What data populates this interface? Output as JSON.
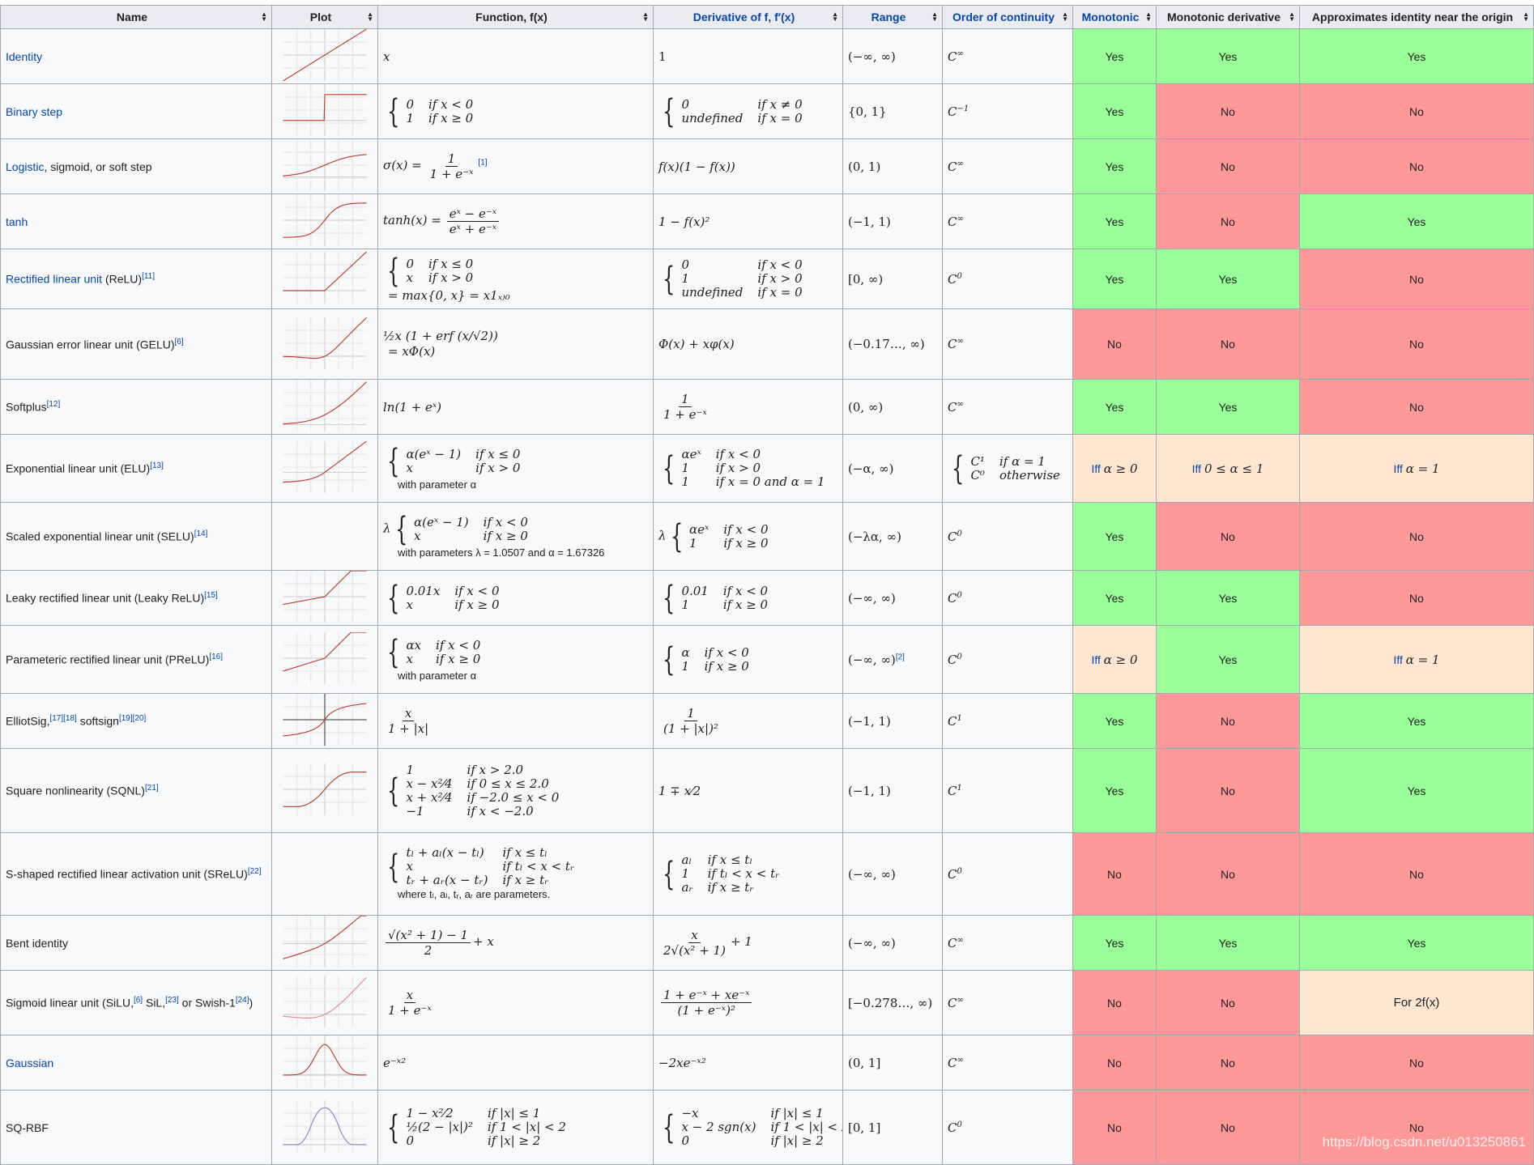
{
  "colors": {
    "yes": "#9f9",
    "no": "#f99",
    "partial": "#ffe6d0",
    "link": "#0645ad",
    "header_bg": "#eaecf0",
    "border": "#a2a9b1"
  },
  "headers": [
    {
      "label": "Name",
      "link": false
    },
    {
      "label": "Plot",
      "link": false,
      "nosort": false
    },
    {
      "label": "Function, f(x)",
      "link": false
    },
    {
      "label": "Derivative of f, f′(x)",
      "link": true
    },
    {
      "label": "Range",
      "link": true
    },
    {
      "label": "Order of continuity",
      "link": true
    },
    {
      "label": "Monotonic",
      "link": true
    },
    {
      "label": "Monotonic derivative",
      "link": false
    },
    {
      "label": "Approximates identity near the origin",
      "link": false
    }
  ],
  "sort_icon": "sort-arrows-icon",
  "rows": [
    {
      "name": [
        {
          "t": "Identity",
          "link": true
        }
      ],
      "plot": "identity",
      "f": {
        "text": "x"
      },
      "d": {
        "text": "1",
        "up": true
      },
      "range": "(−∞, ∞)",
      "cont": {
        "base": "C",
        "sup": "∞"
      },
      "mono": {
        "t": "Yes",
        "s": "yes"
      },
      "monod": {
        "t": "Yes",
        "s": "yes"
      },
      "approx": {
        "t": "Yes",
        "s": "yes"
      }
    },
    {
      "name": [
        {
          "t": "Binary step",
          "link": true
        }
      ],
      "plot": "step",
      "f": {
        "cases": [
          [
            "0",
            "if x < 0"
          ],
          [
            "1",
            "if x ≥ 0"
          ]
        ]
      },
      "d": {
        "cases": [
          [
            "0",
            "if x ≠ 0"
          ],
          [
            "undefined",
            "if x = 0"
          ]
        ]
      },
      "range": "{0, 1}",
      "cont": {
        "base": "C",
        "sup": "−1"
      },
      "mono": {
        "t": "Yes",
        "s": "yes"
      },
      "monod": {
        "t": "No",
        "s": "no"
      },
      "approx": {
        "t": "No",
        "s": "no"
      }
    },
    {
      "name": [
        {
          "t": "Logistic",
          "link": true
        },
        {
          "t": ", sigmoid, or soft step"
        }
      ],
      "plot": "logistic",
      "f": {
        "pre": "σ(x) =",
        "frac": {
          "num": "1",
          "den": "1 + e⁻ˣ"
        },
        "ref": "[1]"
      },
      "d": {
        "text": "f(x)(1 − f(x))"
      },
      "range": "(0, 1)",
      "cont": {
        "base": "C",
        "sup": "∞"
      },
      "mono": {
        "t": "Yes",
        "s": "yes"
      },
      "monod": {
        "t": "No",
        "s": "no"
      },
      "approx": {
        "t": "No",
        "s": "no"
      }
    },
    {
      "name": [
        {
          "t": "tanh",
          "link": true
        }
      ],
      "plot": "tanh",
      "f": {
        "pre": "tanh(x) =",
        "frac": {
          "num": "eˣ − e⁻ˣ",
          "den": "eˣ + e⁻ˣ"
        }
      },
      "d": {
        "text": "1 − f(x)²"
      },
      "range": "(−1, 1)",
      "cont": {
        "base": "C",
        "sup": "∞"
      },
      "mono": {
        "t": "Yes",
        "s": "yes"
      },
      "monod": {
        "t": "No",
        "s": "no"
      },
      "approx": {
        "t": "Yes",
        "s": "yes"
      }
    },
    {
      "name": [
        {
          "t": "Rectified linear unit",
          "link": true
        },
        {
          "t": " (ReLU)"
        },
        {
          "t": "[11]",
          "sup": true
        }
      ],
      "plot": "relu",
      "f": {
        "cases": [
          [
            "0",
            "if x ≤ 0"
          ],
          [
            "x",
            "if x > 0"
          ]
        ],
        "after": "= max{0, x} = x1ₓ₎₀"
      },
      "d": {
        "cases": [
          [
            "0",
            "if x < 0"
          ],
          [
            "1",
            "if x > 0"
          ],
          [
            "undefined",
            "if x = 0"
          ]
        ]
      },
      "range": "[0, ∞)",
      "cont": {
        "base": "C",
        "sup": "0"
      },
      "mono": {
        "t": "Yes",
        "s": "yes"
      },
      "monod": {
        "t": "Yes",
        "s": "yes"
      },
      "approx": {
        "t": "No",
        "s": "no"
      }
    },
    {
      "name": [
        {
          "t": "Gaussian error linear unit (GELU)"
        },
        {
          "t": "[6]",
          "sup": true
        }
      ],
      "plot": "gelu",
      "f": {
        "text": "½x (1 + erf (x/√2))",
        "after": "= xΦ(x)"
      },
      "d": {
        "text": "Φ(x) + xφ(x)"
      },
      "range": "(−0.17…, ∞)",
      "cont": {
        "base": "C",
        "sup": "∞"
      },
      "mono": {
        "t": "No",
        "s": "no"
      },
      "monod": {
        "t": "No",
        "s": "no"
      },
      "approx": {
        "t": "No",
        "s": "no"
      }
    },
    {
      "name": [
        {
          "t": "Softplus"
        },
        {
          "t": "[12]",
          "sup": true
        }
      ],
      "plot": "softplus",
      "f": {
        "text": "ln(1 + eˣ)"
      },
      "d": {
        "frac": {
          "num": "1",
          "den": "1 + e⁻ˣ"
        }
      },
      "range": "(0, ∞)",
      "cont": {
        "base": "C",
        "sup": "∞"
      },
      "mono": {
        "t": "Yes",
        "s": "yes"
      },
      "monod": {
        "t": "Yes",
        "s": "yes"
      },
      "approx": {
        "t": "No",
        "s": "no"
      }
    },
    {
      "name": [
        {
          "t": "Exponential linear unit (ELU)"
        },
        {
          "t": "[13]",
          "sup": true
        }
      ],
      "plot": "elu",
      "f": {
        "cases": [
          [
            "α(eˣ − 1)",
            "if x ≤ 0"
          ],
          [
            "x",
            "if x > 0"
          ]
        ],
        "note": "with parameter α"
      },
      "d": {
        "cases": [
          [
            "αeˣ",
            "if x < 0"
          ],
          [
            "1",
            "if x > 0"
          ],
          [
            "1",
            "if x = 0 and α = 1"
          ]
        ]
      },
      "range": "(−α, ∞)",
      "cont": {
        "cases": [
          [
            "C¹",
            "if α = 1"
          ],
          [
            "C⁰",
            "otherwise"
          ]
        ]
      },
      "mono": {
        "iff": "Iff",
        "t": "α ≥ 0",
        "s": "partial"
      },
      "monod": {
        "iff": "Iff",
        "t": "0 ≤ α ≤ 1",
        "s": "partial"
      },
      "approx": {
        "iff": "Iff",
        "t": "α = 1",
        "s": "partial"
      }
    },
    {
      "name": [
        {
          "t": "Scaled exponential linear unit (SELU)"
        },
        {
          "t": "[14]",
          "sup": true
        }
      ],
      "plot": "",
      "f": {
        "prefix": "λ",
        "cases": [
          [
            "α(eˣ − 1)",
            "if x < 0"
          ],
          [
            "x",
            "if x ≥ 0"
          ]
        ],
        "note": "with parameters λ = 1.0507 and α = 1.67326"
      },
      "d": {
        "prefix": "λ",
        "cases": [
          [
            "αeˣ",
            "if x < 0"
          ],
          [
            "1",
            "if x ≥ 0"
          ]
        ]
      },
      "range": "(−λα, ∞)",
      "cont": {
        "base": "C",
        "sup": "0"
      },
      "mono": {
        "t": "Yes",
        "s": "yes"
      },
      "monod": {
        "t": "No",
        "s": "no"
      },
      "approx": {
        "t": "No",
        "s": "no"
      }
    },
    {
      "name": [
        {
          "t": "Leaky rectified linear unit (Leaky ReLU)"
        },
        {
          "t": "[15]",
          "sup": true
        }
      ],
      "plot": "leaky",
      "f": {
        "cases": [
          [
            "0.01x",
            "if x < 0"
          ],
          [
            "x",
            "if x ≥ 0"
          ]
        ]
      },
      "d": {
        "cases": [
          [
            "0.01",
            "if x < 0"
          ],
          [
            "1",
            "if x ≥ 0"
          ]
        ]
      },
      "range": "(−∞, ∞)",
      "cont": {
        "base": "C",
        "sup": "0"
      },
      "mono": {
        "t": "Yes",
        "s": "yes"
      },
      "monod": {
        "t": "Yes",
        "s": "yes"
      },
      "approx": {
        "t": "No",
        "s": "no"
      }
    },
    {
      "name": [
        {
          "t": "Parameteric rectified linear unit (PReLU)"
        },
        {
          "t": "[16]",
          "sup": true
        }
      ],
      "plot": "prelu",
      "f": {
        "cases": [
          [
            "αx",
            "if x < 0"
          ],
          [
            "x",
            "if x ≥ 0"
          ]
        ],
        "note": "with parameter α"
      },
      "d": {
        "cases": [
          [
            "α",
            "if x < 0"
          ],
          [
            "1",
            "if x ≥ 0"
          ]
        ]
      },
      "range": "(−∞, ∞)",
      "range_ref": "[2]",
      "cont": {
        "base": "C",
        "sup": "0"
      },
      "mono": {
        "iff": "Iff",
        "t": "α ≥ 0",
        "s": "partial"
      },
      "monod": {
        "t": "Yes",
        "s": "yes"
      },
      "approx": {
        "iff": "Iff",
        "t": "α = 1",
        "s": "partial"
      }
    },
    {
      "name": [
        {
          "t": "ElliotSig,"
        },
        {
          "t": "[17][18]",
          "sup": true
        },
        {
          "t": " softsign"
        },
        {
          "t": "[19][20]",
          "sup": true
        }
      ],
      "plot": "elliot",
      "f": {
        "frac": {
          "num": "x",
          "den": "1 + |x|"
        }
      },
      "d": {
        "frac": {
          "num": "1",
          "den": "(1 + |x|)²"
        }
      },
      "range": "(−1, 1)",
      "cont": {
        "base": "C",
        "sup": "1"
      },
      "mono": {
        "t": "Yes",
        "s": "yes"
      },
      "monod": {
        "t": "No",
        "s": "no"
      },
      "approx": {
        "t": "Yes",
        "s": "yes"
      }
    },
    {
      "name": [
        {
          "t": "Square nonlinearity (SQNL)"
        },
        {
          "t": "[21]",
          "sup": true
        }
      ],
      "plot": "sqnl",
      "f": {
        "cases": [
          [
            "1",
            "if x > 2.0"
          ],
          [
            "x − x²⁄4",
            "if 0 ≤ x ≤ 2.0"
          ],
          [
            "x + x²⁄4",
            "if −2.0 ≤ x < 0"
          ],
          [
            "−1",
            "if x < −2.0"
          ]
        ]
      },
      "d": {
        "text": "1 ∓ x⁄2"
      },
      "range": "(−1, 1)",
      "cont": {
        "base": "C",
        "sup": "1"
      },
      "mono": {
        "t": "Yes",
        "s": "yes"
      },
      "monod": {
        "t": "No",
        "s": "no"
      },
      "approx": {
        "t": "Yes",
        "s": "yes"
      }
    },
    {
      "name": [
        {
          "t": "S-shaped rectified linear activation unit (SReLU)"
        },
        {
          "t": "[22]",
          "sup": true
        }
      ],
      "plot": "",
      "f": {
        "cases": [
          [
            "tₗ + aₗ(x − tₗ)",
            "if x ≤ tₗ"
          ],
          [
            "x",
            "if tₗ < x < tᵣ"
          ],
          [
            "tᵣ + aᵣ(x − tᵣ)",
            "if x ≥ tᵣ"
          ]
        ],
        "note": "where tₗ, aₗ, tᵣ, aᵣ are parameters."
      },
      "d": {
        "cases": [
          [
            "aₗ",
            "if x ≤ tₗ"
          ],
          [
            "1",
            "if tₗ < x < tᵣ"
          ],
          [
            "aᵣ",
            "if x ≥ tᵣ"
          ]
        ]
      },
      "range": "(−∞, ∞)",
      "cont": {
        "base": "C",
        "sup": "0"
      },
      "mono": {
        "t": "No",
        "s": "no"
      },
      "monod": {
        "t": "No",
        "s": "no"
      },
      "approx": {
        "t": "No",
        "s": "no"
      }
    },
    {
      "name": [
        {
          "t": "Bent identity"
        }
      ],
      "plot": "bent",
      "f": {
        "frac": {
          "num": "√(x² + 1) − 1",
          "den": "2"
        },
        "post": "+ x"
      },
      "d": {
        "frac": {
          "num": "x",
          "den": "2√(x² + 1)"
        },
        "post": "+ 1"
      },
      "range": "(−∞, ∞)",
      "cont": {
        "base": "C",
        "sup": "∞"
      },
      "mono": {
        "t": "Yes",
        "s": "yes"
      },
      "monod": {
        "t": "Yes",
        "s": "yes"
      },
      "approx": {
        "t": "Yes",
        "s": "yes"
      }
    },
    {
      "name": [
        {
          "t": "Sigmoid linear unit (SiLU,"
        },
        {
          "t": "[6]",
          "sup": true
        },
        {
          "t": " SiL,"
        },
        {
          "t": "[23]",
          "sup": true
        },
        {
          "t": " or Swish-1"
        },
        {
          "t": "[24]",
          "sup": true
        },
        {
          "t": ")"
        }
      ],
      "plot": "silu",
      "f": {
        "frac": {
          "num": "x",
          "den": "1 + e⁻ˣ"
        }
      },
      "d": {
        "frac": {
          "num": "1 + e⁻ˣ + xe⁻ˣ",
          "den": "(1 + e⁻ˣ)²"
        }
      },
      "range": "[−0.278…, ∞)",
      "cont": {
        "base": "C",
        "sup": "∞"
      },
      "mono": {
        "t": "No",
        "s": "no"
      },
      "monod": {
        "t": "No",
        "s": "no"
      },
      "approx": {
        "t": "For 2f(x)",
        "s": "partial"
      }
    },
    {
      "name": [
        {
          "t": "Gaussian",
          "link": true
        }
      ],
      "plot": "gaussian",
      "f": {
        "text": "e⁻ˣ²"
      },
      "d": {
        "text": "−2xe⁻ˣ²"
      },
      "range": "(0, 1]",
      "cont": {
        "base": "C",
        "sup": "∞"
      },
      "mono": {
        "t": "No",
        "s": "no"
      },
      "monod": {
        "t": "No",
        "s": "no"
      },
      "approx": {
        "t": "No",
        "s": "no"
      }
    },
    {
      "name": [
        {
          "t": "SQ-RBF"
        }
      ],
      "plot": "sqrbf",
      "f": {
        "cases": [
          [
            "1 − x²⁄2",
            "if |x| ≤ 1"
          ],
          [
            "½(2 − |x|)²",
            "if 1 < |x| < 2"
          ],
          [
            "0",
            "if |x| ≥ 2"
          ]
        ]
      },
      "d": {
        "cases": [
          [
            "−x",
            "if |x| ≤ 1"
          ],
          [
            "x − 2 sgn(x)",
            "if 1 < |x| < 2"
          ],
          [
            "0",
            "if |x| ≥ 2"
          ]
        ]
      },
      "range": "[0, 1]",
      "cont": {
        "base": "C",
        "sup": "0"
      },
      "mono": {
        "t": "No",
        "s": "no"
      },
      "monod": {
        "t": "No",
        "s": "no"
      },
      "approx": {
        "t": "No",
        "s": "no"
      }
    }
  ],
  "watermark": "https://blog.csdn.net/u013250861"
}
